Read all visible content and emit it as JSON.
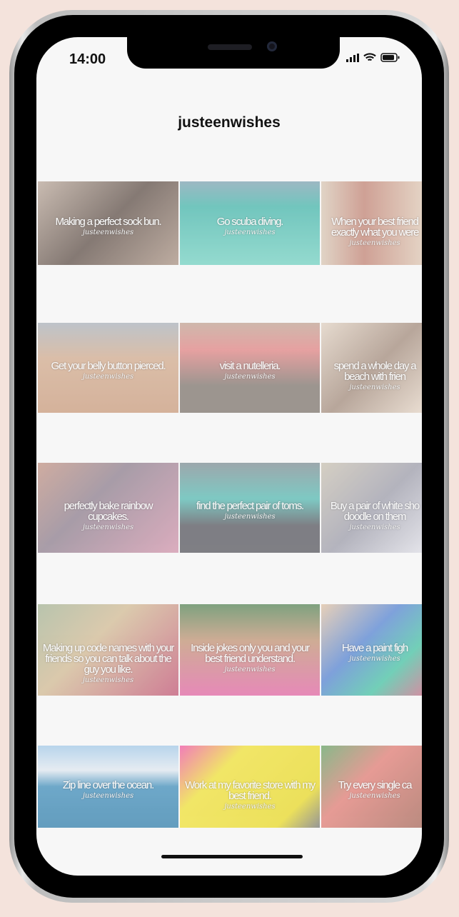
{
  "status_bar": {
    "time": "14:00"
  },
  "header": {
    "title": "justeenwishes"
  },
  "watermark": "justeenwishes",
  "posts": [
    {
      "caption": "Making a perfect sock bun.",
      "bg": "linear-gradient(135deg,#b8a597,#5a4a42 50%,#a89080)"
    },
    {
      "caption": "Go scuba diving.",
      "bg": "linear-gradient(180deg,#7aa0b0,#3fb3a8 30%,#6fd0c0)"
    },
    {
      "caption": "When your best friend\nexactly what you were",
      "bg": "linear-gradient(90deg,#d8c7b4,#c08070 40%,#e0cdb8)"
    },
    {
      "caption": "Get your belly button pierced.",
      "bg": "linear-gradient(180deg,#a8b0b8,#d0a88a 40%,#c89878)"
    },
    {
      "caption": "visit a nutelleria.",
      "bg": "linear-gradient(180deg,#c0a090,#e08080 30%,#7a7068 70%)"
    },
    {
      "caption": "spend a whole day a\nbeach with frien",
      "bg": "linear-gradient(135deg,#e0d0c0,#a08878 50%,#e8d8c8)"
    },
    {
      "caption": "perfectly bake rainbow\ncupcakes.",
      "bg": "linear-gradient(135deg,#c09080,#8a7a8a 40%,#d090a8)"
    },
    {
      "caption": "find the perfect pair of toms.",
      "bg": "linear-gradient(180deg,#7a8a90,#50b8b0 40%,#505058 70%)"
    },
    {
      "caption": "Buy a pair of white sho\ndoodle on them",
      "bg": "linear-gradient(135deg,#c8c0b0,#9a9aa8 50%,#e0e0e8)"
    },
    {
      "caption": "Making up code names with your\nfriends so you can talk about the\nguy you like.",
      "bg": "linear-gradient(135deg,#a0b090,#d0b890 40%,#c05070)"
    },
    {
      "caption": "Inside jokes only you and your\nbest friend understand.",
      "bg": "linear-gradient(180deg,#508050,#c09070 40%,#e060a0)"
    },
    {
      "caption": "Have a paint figh",
      "bg": "linear-gradient(135deg,#e0c0a0,#5080d0 40%,#40c0a0 70%,#d06080)"
    },
    {
      "caption": "Zip line over the ocean.",
      "bg": "linear-gradient(180deg,#a0c8e8,#e0e8f0 30%,#3a8ab8 50%,#2a7aa8)"
    },
    {
      "caption": "Work at my favorite store with my\nbest friend.",
      "bg": "linear-gradient(135deg,#f050a0,#f0e030 30%,#e8d820 80%,#707070)"
    },
    {
      "caption": "Try every single ca",
      "bg": "linear-gradient(135deg,#60a060,#e07870 40%,#a06050)"
    }
  ]
}
